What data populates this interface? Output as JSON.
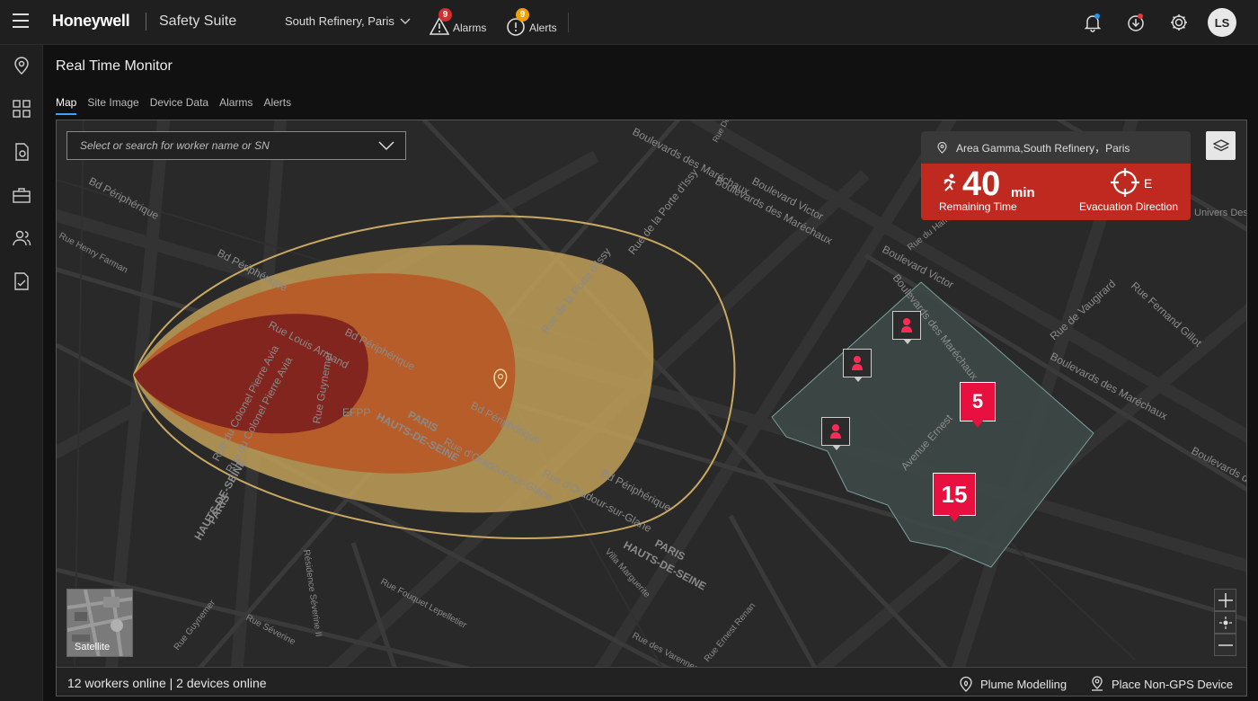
{
  "header": {
    "logo": "Honeywell",
    "app_title": "Safety Suite",
    "site": "South Refinery, Paris",
    "alarms": {
      "label": "Alarms",
      "count": "9"
    },
    "alerts": {
      "label": "Alerts",
      "count": "9"
    },
    "user_initials": "LS"
  },
  "page": {
    "title": "Real Time Monitor",
    "tabs": [
      {
        "label": "Map",
        "active": true
      },
      {
        "label": "Site Image"
      },
      {
        "label": "Device Data"
      },
      {
        "label": "Alarms"
      },
      {
        "label": "Alerts"
      }
    ]
  },
  "map": {
    "search_placeholder": "Select or search for worker name or SN",
    "area": {
      "name": "Area Gamma,South Refinery，Paris",
      "remaining_value": "40",
      "remaining_unit": "min",
      "remaining_label": "Remaining Time",
      "direction": "E",
      "direction_label": "Evacuation Direction"
    },
    "clusters": [
      "5",
      "15"
    ],
    "satellite_label": "Satellite",
    "road_labels": [
      "Bd Périphérique",
      "Bd Périphérique",
      "Rue Louis Armand",
      "Rue du Colonel Pierre Avia",
      "Rue du Colonel Pierre Avia",
      "Rue Guynemer",
      "Bd Périphérique",
      "Rue d'Oradour-sur-Glane",
      "Rue d'Oradour-sur-Glane",
      "Bd Périphérique",
      "Rue de la Porte d'Issy",
      "Rue de la Porte d'Issy",
      "Boulevard Victor",
      "Boulevards des Maréchaux",
      "Boulevards des Maréchaux",
      "Boulevard Victor",
      "Boulevards des Maréchaux",
      "Rue de Vaugirard",
      "Rue Fernand Gillot",
      "Boulevards des Maréchaux",
      "Boulevards des Maréchaux",
      "Avenue Ernest",
      "Rue Henry Farman",
      "Bd Périphérique",
      "Rue Fouquet Lepelletier",
      "Villa Marguerite",
      "Résidence Séverine II",
      "Rue Séverine",
      "Rue Guynemer",
      "Rue Ernest Renan",
      "Rue des Varennes",
      "Rue du Hameau",
      "Rue Desnouettes",
      "Univers Descartes",
      "EFPP"
    ],
    "region_labels": [
      "PARIS",
      "HAUTS-DE-SEINE",
      "PARIS",
      "HAUTS-DE-SEINE",
      "PARIS",
      "HAUTS-DE-SEINE"
    ],
    "status": "12 workers online | 2 devices online",
    "plume_label": "Plume Modelling",
    "place_device_label": "Place Non-GPS Device"
  },
  "colors": {
    "accent": "#3fa0ff",
    "alarm": "#d32f2f",
    "alert": "#f0a000",
    "evac": "#c0291f",
    "cluster": "#e8103e"
  }
}
